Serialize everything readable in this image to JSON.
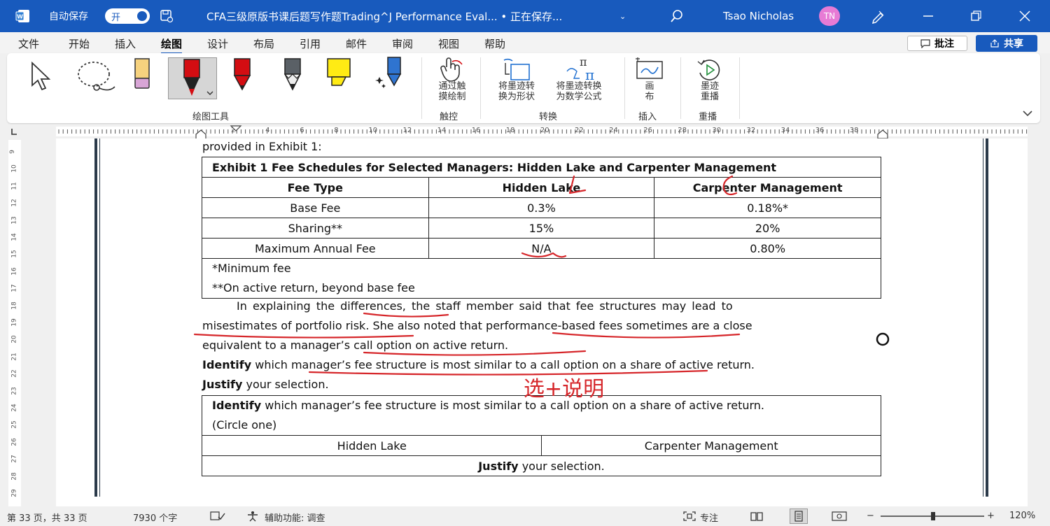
{
  "titlebar": {
    "autosave_label": "自动保存",
    "autosave_state": "开",
    "doc_title": "CFA三级原版书课后题写作题Trading^J Performance Eval... • 正在保存...",
    "title_caret": "⌄",
    "user_name": "Tsao Nicholas",
    "avatar_initials": "TN",
    "accent_color": "#185abd"
  },
  "menu": {
    "tabs": [
      "文件",
      "开始",
      "插入",
      "绘图",
      "设计",
      "布局",
      "引用",
      "邮件",
      "审阅",
      "视图",
      "帮助"
    ],
    "active_tab": "绘图",
    "comment_label": "批注",
    "share_label": "共享"
  },
  "ribbon": {
    "drawing_tools_label": "绘图工具",
    "touch_draw_label_1": "通过触",
    "touch_draw_label_2": "摸绘制",
    "touch_group": "触控",
    "ink_to_shape_1": "将墨迹转",
    "ink_to_shape_2": "换为形状",
    "ink_to_math_1": "将墨迹转换",
    "ink_to_math_2": "为数学公式",
    "convert_group": "转换",
    "canvas_1": "画",
    "canvas_2": "布",
    "insert_group": "插入",
    "replay_1": "墨迹",
    "replay_2": "重播",
    "replay_group": "重播"
  },
  "ruler": {
    "h_numbers": [
      "2",
      "4",
      "6",
      "8",
      "10",
      "12",
      "14",
      "16",
      "18",
      "20",
      "22",
      "24",
      "26",
      "28",
      "30",
      "32",
      "34",
      "36",
      "38"
    ],
    "v_numbers": [
      "9",
      "10",
      "11",
      "12",
      "13",
      "14",
      "15",
      "16",
      "17",
      "18",
      "19",
      "20",
      "21",
      "22",
      "23",
      "24",
      "25",
      "26",
      "27",
      "28",
      "29"
    ]
  },
  "document": {
    "intro_line": "provided in Exhibit 1:",
    "exhibit_title": "Exhibit 1 Fee Schedules for Selected Managers: Hidden Lake and Carpenter Management",
    "headers": [
      "Fee Type",
      "Hidden Lake",
      "Carpenter Management"
    ],
    "rows": [
      [
        "Base Fee",
        "0.3%",
        "0.18%*"
      ],
      [
        "Sharing**",
        "15%",
        "20%"
      ],
      [
        "Maximum Annual Fee",
        "N/A",
        "0.80%"
      ]
    ],
    "note_1": "*Minimum fee",
    "note_2": "**On active return, beyond base fee",
    "para_line_1": "In  explaining  the  differences,  the  staff  member  said  that  fee  structures  may  lead  to",
    "para_line_2": "misestimates of portfolio risk. She also noted that performance-based fees sometimes are a close",
    "para_line_3": "equivalent to a manager’s call option on active return.",
    "identify_bold": "Identify",
    "identify_rest": " which manager’s fee structure is most similar to a call option on a share of active return.",
    "justify_bold": "Justify",
    "justify_rest": " your selection.",
    "answer_q_bold": "Identify",
    "answer_q_rest": " which manager’s fee structure is most similar to a call option on a share of active return.",
    "answer_q_line2": "(Circle one)",
    "choice_1": "Hidden Lake",
    "choice_2": "Carpenter Management",
    "answer_justify_bold": "Justify",
    "answer_justify_rest": " your selection.",
    "ink_note": "选+说明",
    "ink_color": "#d6262a"
  },
  "status": {
    "page_info": "第 33 页，共 33 页",
    "word_count": "7930 个字",
    "accessibility": "辅助功能: 调查",
    "focus": "专注",
    "zoom": "120%",
    "zoom_minus": "−",
    "zoom_plus": "+"
  }
}
